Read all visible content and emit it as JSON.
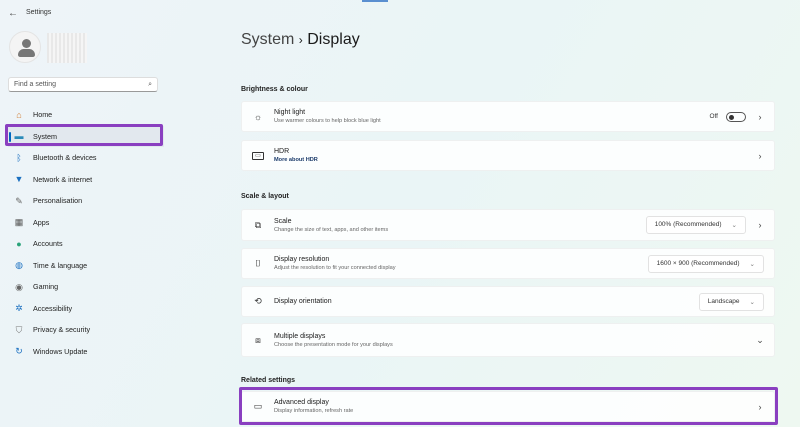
{
  "app": {
    "title": "Settings",
    "back_icon": "back-arrow-icon"
  },
  "search": {
    "placeholder": "Find a setting"
  },
  "nav": [
    {
      "label": "Home",
      "icon": "home-icon",
      "glyph": "⌂",
      "color": "#d07a30"
    },
    {
      "label": "System",
      "icon": "system-icon",
      "glyph": "▬",
      "color": "#2a8ab8",
      "active": true
    },
    {
      "label": "Bluetooth & devices",
      "icon": "bluetooth-icon",
      "glyph": "ᛒ",
      "color": "#1a6fc0"
    },
    {
      "label": "Network & internet",
      "icon": "wifi-icon",
      "glyph": "▼",
      "color": "#1a6fc0"
    },
    {
      "label": "Personalisation",
      "icon": "brush-icon",
      "glyph": "✎",
      "color": "#666"
    },
    {
      "label": "Apps",
      "icon": "apps-icon",
      "glyph": "▦",
      "color": "#555"
    },
    {
      "label": "Accounts",
      "icon": "accounts-icon",
      "glyph": "●",
      "color": "#2aa37a"
    },
    {
      "label": "Time & language",
      "icon": "globe-icon",
      "glyph": "◍",
      "color": "#1a6fc0"
    },
    {
      "label": "Gaming",
      "icon": "gaming-icon",
      "glyph": "◉",
      "color": "#666"
    },
    {
      "label": "Accessibility",
      "icon": "accessibility-icon",
      "glyph": "✲",
      "color": "#1a6fc0"
    },
    {
      "label": "Privacy & security",
      "icon": "shield-icon",
      "glyph": "⛉",
      "color": "#777"
    },
    {
      "label": "Windows Update",
      "icon": "update-icon",
      "glyph": "↻",
      "color": "#1a6fc0"
    }
  ],
  "breadcrumb": {
    "parent": "System",
    "sep": "›",
    "current": "Display"
  },
  "sections": {
    "brightness": "Brightness & colour",
    "scale": "Scale & layout",
    "related": "Related settings"
  },
  "cards": {
    "night_light": {
      "title": "Night light",
      "subtitle": "Use warmer colours to help block blue light",
      "state": "Off"
    },
    "hdr": {
      "title": "HDR",
      "link": "More about HDR"
    },
    "scale": {
      "title": "Scale",
      "subtitle": "Change the size of text, apps, and other items",
      "value": "100% (Recommended)"
    },
    "resolution": {
      "title": "Display resolution",
      "subtitle": "Adjust the resolution to fit your connected display",
      "value": "1600 × 900 (Recommended)"
    },
    "orientation": {
      "title": "Display orientation",
      "value": "Landscape"
    },
    "multiple": {
      "title": "Multiple displays",
      "subtitle": "Choose the presentation mode for your displays"
    },
    "advanced": {
      "title": "Advanced display",
      "subtitle": "Display information, refresh rate"
    }
  },
  "colors": {
    "highlight": "#8a3fc0",
    "accent": "#0067c0"
  }
}
